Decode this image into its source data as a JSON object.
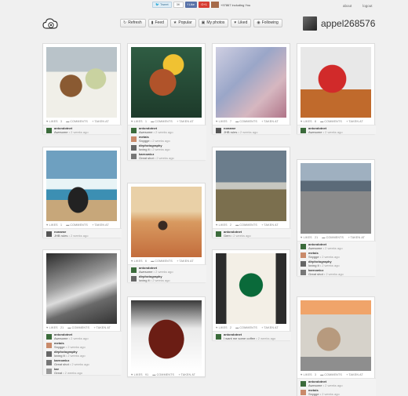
{
  "sharebar": {
    "tweet": "Tweet",
    "tweet_count": "3K",
    "like": "Like",
    "gplus": "G+1",
    "text": "+97867 including You"
  },
  "toplinks": {
    "about": "about",
    "logout": "logout"
  },
  "nav": {
    "refresh": "Refresh",
    "feed": "Feed",
    "popular": "Popular",
    "my_photos": "My photos",
    "liked": "Liked",
    "following": "Following"
  },
  "user": {
    "name": "appel268576"
  },
  "stat_labels": {
    "likes": "LIKES",
    "comments": "COMMENTS",
    "taken_at": "TAKEN AT"
  },
  "posts": [
    {
      "likes": "3",
      "comments": [
        {
          "name": "antondotnet",
          "text": "Awesome",
          "time": "2 weeks ago"
        }
      ]
    },
    {
      "likes": "1",
      "comments": [
        {
          "name": "noname",
          "text": "JHB rules",
          "time": "2 weeks ago"
        }
      ]
    },
    {
      "likes": "21",
      "comments": [
        {
          "name": "antondotnet",
          "text": "Awesome",
          "time": "2 weeks ago"
        },
        {
          "name": "metais",
          "text": "Snygge",
          "time": "2 weeks ago"
        },
        {
          "name": "dirphotography",
          "text": "loving it",
          "time": "2 weeks ago"
        },
        {
          "name": "karnowicz",
          "text": "Great shot",
          "time": "2 weeks ago"
        },
        {
          "name": "kar",
          "text": "Great",
          "time": "2 weeks ago"
        }
      ]
    },
    {
      "likes": "1",
      "comments": [
        {
          "name": "antondotnet",
          "text": "Awesome",
          "time": "2 weeks ago"
        },
        {
          "name": "metais",
          "text": "Snygge",
          "time": "2 weeks ago"
        },
        {
          "name": "dirphotography",
          "text": "loving it",
          "time": "2 weeks ago"
        },
        {
          "name": "karnowicz",
          "text": "Great shot",
          "time": "2 weeks ago"
        }
      ]
    },
    {
      "likes": "6",
      "comments": [
        {
          "name": "antondotnet",
          "text": "Awesome",
          "time": "2 weeks ago"
        },
        {
          "name": "dirphotography",
          "text": "loving it",
          "time": "2 weeks ago"
        }
      ]
    },
    {
      "likes": "91",
      "comments": []
    },
    {
      "likes": "7",
      "comments": [
        {
          "name": "noname",
          "text": "JHB rules",
          "time": "2 weeks ago"
        }
      ]
    },
    {
      "likes": "2",
      "comments": [
        {
          "name": "antondotnet",
          "text": "Gem",
          "time": "2 weeks ago"
        }
      ]
    },
    {
      "likes": "2",
      "comments": [
        {
          "name": "antondotnet",
          "text": "I want me some coffee",
          "time": "2 weeks ago"
        }
      ]
    },
    {
      "likes": "8",
      "comments": [
        {
          "name": "antondotnet",
          "text": "Awesome",
          "time": "2 weeks ago"
        }
      ]
    },
    {
      "likes": "21",
      "comments": [
        {
          "name": "antondotnet",
          "text": "Awesome",
          "time": "2 weeks ago"
        },
        {
          "name": "metais",
          "text": "Snygge",
          "time": "2 weeks ago"
        },
        {
          "name": "dirphotography",
          "text": "loving it",
          "time": "2 weeks ago"
        },
        {
          "name": "karnowicz",
          "text": "Great shot",
          "time": "2 weeks ago"
        }
      ]
    },
    {
      "likes": "3",
      "comments": [
        {
          "name": "antondotnet",
          "text": "Awesome",
          "time": "2 weeks ago"
        },
        {
          "name": "metais",
          "text": "Snygge",
          "time": "2 weeks ago"
        }
      ]
    }
  ]
}
